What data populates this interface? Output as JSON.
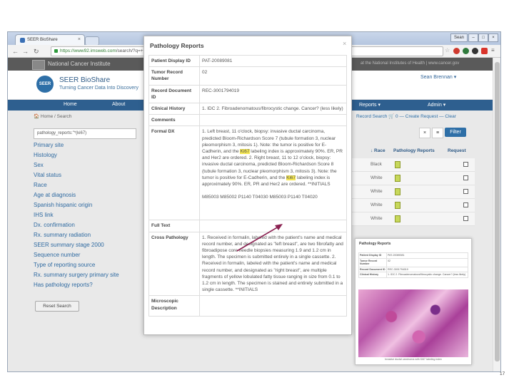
{
  "browser": {
    "tab_title": "SEER BioShare",
    "user_badge": "Sean",
    "url_host": "https://www92.imsweb.com",
    "url_path": "/search/?q=+pathology_reports%3C%2A%3A%28ki67%29"
  },
  "site": {
    "agency": "National Cancer Institute",
    "nih": "at the National Institutes of Health | www.cancer.gov",
    "logo_text": "SEER",
    "title": "SEER BioShare",
    "tagline": "Turning Cancer Data Into Discovery",
    "user": "Sean Brennan ▾",
    "nav": [
      "Home",
      "About",
      "Reports ▾",
      "Admin ▾"
    ],
    "breadcrumb": "🏠 Home  /  Search",
    "breadcrumb_right": "Record Search    🛒 0 — Create Request — Clear",
    "search_value": "pathology_reports:\"*(ki67)",
    "filter_label": "Filter",
    "facets": [
      "Primary site",
      "Histology",
      "Sex",
      "Vital status",
      "Race",
      "Age at diagnosis",
      "Spanish hispanic origin",
      "IHS link",
      "Dx. confirmation",
      "Rx. summary radiation",
      "SEER summary stage 2000",
      "Sequence number",
      "Type of reporting source",
      "Rx. summary surgery primary site",
      "Has pathology reports?"
    ],
    "reset_label": "Reset Search",
    "table_headers": [
      "↓ Race",
      "Pathology Reports",
      "Request"
    ],
    "rows": [
      {
        "race": "Black"
      },
      {
        "race": "White"
      },
      {
        "race": "White"
      },
      {
        "race": "White"
      },
      {
        "race": "White"
      }
    ]
  },
  "modal": {
    "title": "Pathology Reports",
    "close": "×",
    "fields": [
      {
        "key": "Patient Display ID",
        "value": "PAT-20089081"
      },
      {
        "key": "Tumor Record Number",
        "value": "02"
      },
      {
        "key": "Record Document ID",
        "value": "REC-3001794019"
      },
      {
        "key": "Clinical History",
        "value": "1. IDC 2. Fibroadenomatous/fibrocystic change. Cancer? (less likely)"
      },
      {
        "key": "Comments",
        "value": ""
      },
      {
        "key": "Formal DX",
        "value": ""
      },
      {
        "key": "Full Text",
        "value": ""
      },
      {
        "key": "Cross Pathology",
        "value": "1. Received in formalin, labeled with the patient's name and medical record number, and designated as \"left breast\", are two fibrofatty and fibroadipose core needle biopsies measuring 1.9 and 1.2 cm in length. The specimen is submitted entirely in a single cassette. 2. Received in formalin, labeled with the patient's name and medical record number, and designated as \"right breast\", are multiple fragments of yellow lobulated fatty tissue ranging in size from 0.1 to 1.2 cm in length. The specimen is stained and entirely submitted in a single cassette. **INITIALS"
      },
      {
        "key": "Microscopic Description",
        "value": ""
      }
    ],
    "formal_dx_parts": [
      "1. Left breast, 11 o'clock, biopsy: invasive ductal carcinoma, predicted Bloom-Richardson Score 7 (tubule formation 3, nuclear pleomorphism 3, mitosis 1). Note: the tumor is positive for E-Cadherin, and the ",
      "Ki67",
      " labeling index is approximately 90%. ER, PR and Her2 are ordered. 2. Right breast, 11 to 12 o'clock, biopsy: invasive ductal carcinoma, predicted Bloom-Richardson Score 8 (tubule formation 3, nuclear pleomorphism 3, mitosis 3). Note: the tumor is positive for E-Cadherin, and the ",
      "Ki67",
      " labeling index is approximately 90%. ER, PR and Her2 are ordered. **INITIALS"
    ],
    "full_text_codes": "M85003 M85002 P1140 T04030 M85003 P1140 T04020"
  },
  "inset": {
    "title": "Pathology Reports",
    "fields": [
      {
        "key": "Patient Display ID",
        "value": "PAT-20089081"
      },
      {
        "key": "Tumor Record Number",
        "value": "02"
      },
      {
        "key": "Record Document ID",
        "value": "REC-3001794019"
      },
      {
        "key": "Clinical History",
        "value": "1. IDC 2. Fibroadenomatous/fibrocystic change. Cancer? (less likely)"
      }
    ],
    "caption": "Invasive ductal carcinoma with Ki67 labeling index"
  },
  "page_number": "17"
}
